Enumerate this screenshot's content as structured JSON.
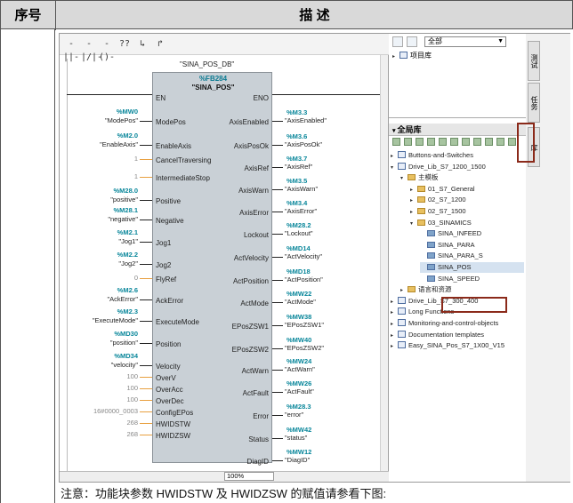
{
  "table_header": {
    "col1": "序号",
    "col2": "描 述"
  },
  "toolbar": {
    "buttons": [
      "-||-",
      "-|/|-",
      "-()-",
      "??",
      "↳",
      "↱"
    ]
  },
  "block": {
    "instance_name": "\"SINA_POS_DB\"",
    "db_number": "%FB284",
    "fb_name": "\"SINA_POS\"",
    "en": "EN",
    "eno": "ENO"
  },
  "inputs": [
    {
      "pin": "ModePos",
      "addr": "%MW0",
      "sym": "\"ModePos\""
    },
    {
      "pin": "EnableAxis",
      "addr": "%M2.0",
      "sym": "\"EnableAxis\""
    },
    {
      "pin": "CancelTraversing",
      "addr": "",
      "sym": "1"
    },
    {
      "pin": "IntermediateStop",
      "addr": "",
      "sym": "1"
    },
    {
      "pin": "Positive",
      "addr": "%M28.0",
      "sym": "\"positive\""
    },
    {
      "pin": "Negative",
      "addr": "%M28.1",
      "sym": "\"negative\""
    },
    {
      "pin": "Jog1",
      "addr": "%M2.1",
      "sym": "\"Jog1\""
    },
    {
      "pin": "Jog2",
      "addr": "%M2.2",
      "sym": "\"Jog2\""
    },
    {
      "pin": "FlyRef",
      "addr": "",
      "sym": "0"
    },
    {
      "pin": "AckError",
      "addr": "%M2.6",
      "sym": "\"AckError\""
    },
    {
      "pin": "ExecuteMode",
      "addr": "%M2.3",
      "sym": "\"ExecuteMode\""
    },
    {
      "pin": "Position",
      "addr": "%MD30",
      "sym": "\"position\""
    },
    {
      "pin": "Velocity",
      "addr": "%MD34",
      "sym": "\"velocity\""
    },
    {
      "pin": "OverV",
      "addr": "",
      "sym": "100"
    },
    {
      "pin": "OverAcc",
      "addr": "",
      "sym": "100"
    },
    {
      "pin": "OverDec",
      "addr": "",
      "sym": "100"
    },
    {
      "pin": "ConfigEPos",
      "addr": "",
      "sym": "16#0000_0003"
    },
    {
      "pin": "HWIDSTW",
      "addr": "",
      "sym": "268"
    },
    {
      "pin": "HWIDZSW",
      "addr": "",
      "sym": "268"
    }
  ],
  "outputs": [
    {
      "pin": "AxisEnabled",
      "addr": "%M3.3",
      "sym": "\"AxisEnabled\""
    },
    {
      "pin": "AxisPosOk",
      "addr": "%M3.6",
      "sym": "\"AxisPosOk\""
    },
    {
      "pin": "AxisRef",
      "addr": "%M3.7",
      "sym": "\"AxisRef\""
    },
    {
      "pin": "AxisWarn",
      "addr": "%M3.5",
      "sym": "\"AxisWarn\""
    },
    {
      "pin": "AxisError",
      "addr": "%M3.4",
      "sym": "\"AxisError\""
    },
    {
      "pin": "Lockout",
      "addr": "%M28.2",
      "sym": "\"Lockout\""
    },
    {
      "pin": "ActVelocity",
      "addr": "%MD14",
      "sym": "\"ActVelocity\""
    },
    {
      "pin": "ActPosition",
      "addr": "%MD18",
      "sym": "\"ActPosition\""
    },
    {
      "pin": "ActMode",
      "addr": "%MW22",
      "sym": "\"ActMode\""
    },
    {
      "pin": "EPosZSW1",
      "addr": "%MW38",
      "sym": "\"EPosZSW1\""
    },
    {
      "pin": "EPosZSW2",
      "addr": "%MW40",
      "sym": "\"EPosZSW2\""
    },
    {
      "pin": "ActWarn",
      "addr": "%MW24",
      "sym": "\"ActWarn\""
    },
    {
      "pin": "ActFault",
      "addr": "%MW26",
      "sym": "\"ActFault\""
    },
    {
      "pin": "Error",
      "addr": "%M28.3",
      "sym": "\"error\""
    },
    {
      "pin": "Status",
      "addr": "%MW42",
      "sym": "\"status\""
    },
    {
      "pin": "DiagID",
      "addr": "%MW12",
      "sym": "\"DiagID\""
    }
  ],
  "editor": {
    "zoom": "100%"
  },
  "right_panel": {
    "filter_value": "全部",
    "project_lib": "项目库",
    "global_lib": "全局库",
    "tree": [
      {
        "label": "Buttons-and-Switches",
        "depth": 0,
        "icon": "book",
        "twisty": "▸"
      },
      {
        "label": "Drive_Lib_S7_1200_1500",
        "depth": 0,
        "icon": "book",
        "twisty": "▾"
      },
      {
        "label": "主模板",
        "depth": 1,
        "icon": "folder",
        "twisty": "▾"
      },
      {
        "label": "01_S7_General",
        "depth": 2,
        "icon": "folder",
        "twisty": "▸"
      },
      {
        "label": "02_S7_1200",
        "depth": 2,
        "icon": "folder",
        "twisty": "▸"
      },
      {
        "label": "02_S7_1500",
        "depth": 2,
        "icon": "folder",
        "twisty": "▸"
      },
      {
        "label": "03_SINAMICS",
        "depth": 2,
        "icon": "folder",
        "twisty": "▾"
      },
      {
        "label": "SINA_INFEED",
        "depth": 3,
        "icon": "fb",
        "twisty": ""
      },
      {
        "label": "SINA_PARA",
        "depth": 3,
        "icon": "fb",
        "twisty": ""
      },
      {
        "label": "SINA_PARA_S",
        "depth": 3,
        "icon": "fb",
        "twisty": ""
      },
      {
        "label": "SINA_POS",
        "depth": 3,
        "icon": "fb",
        "twisty": ""
      },
      {
        "label": "SINA_SPEED",
        "depth": 3,
        "icon": "fb",
        "twisty": ""
      },
      {
        "label": "语言和资源",
        "depth": 1,
        "icon": "folder",
        "twisty": "▸"
      },
      {
        "label": "Drive_Lib_S7_300_400",
        "depth": 0,
        "icon": "book",
        "twisty": "▸"
      },
      {
        "label": "Long Functions",
        "depth": 0,
        "icon": "book",
        "twisty": "▸"
      },
      {
        "label": "Monitoring-and-control-objects",
        "depth": 0,
        "icon": "book",
        "twisty": "▸"
      },
      {
        "label": "Documentation templates",
        "depth": 0,
        "icon": "book",
        "twisty": "▸"
      },
      {
        "label": "Easy_SINA_Pos_S7_1X00_V15",
        "depth": 0,
        "icon": "book",
        "twisty": "▸"
      }
    ],
    "selected": "SINA_POS"
  },
  "side_tabs": [
    "测试",
    "任务",
    "库"
  ],
  "note": "注意：功能块参数 HWIDSTW 及 HWIDZSW 的赋值请参看下图:"
}
